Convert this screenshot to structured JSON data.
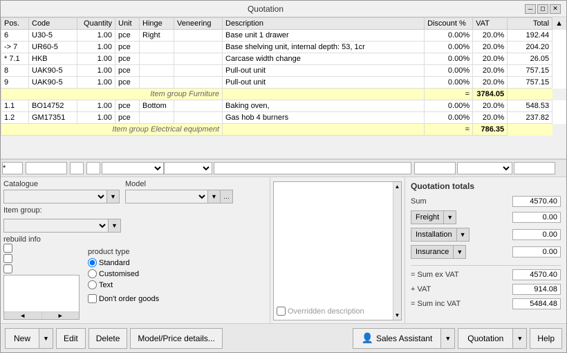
{
  "window": {
    "title": "Quotation"
  },
  "table": {
    "headers": [
      "Pos.",
      "Code",
      "Quantity",
      "Unit",
      "Hinge",
      "Veneering",
      "Description",
      "Discount %",
      "VAT",
      "Total"
    ],
    "rows": [
      {
        "pos": "6",
        "code": "U30-5",
        "qty": "1.00",
        "unit": "pce",
        "hinge": "Right",
        "veneer": "",
        "desc": "Base unit 1 drawer",
        "disc": "0.00%",
        "vat": "20.0%",
        "total": "192.44",
        "type": "normal"
      },
      {
        "pos": "-> 7",
        "code": "UR60-5",
        "qty": "1.00",
        "unit": "pce",
        "hinge": "",
        "veneer": "",
        "desc": "Base shelving unit, internal depth: 53, 1cr",
        "disc": "0.00%",
        "vat": "20.0%",
        "total": "204.20",
        "type": "normal"
      },
      {
        "pos": "* 7.1",
        "code": "HKB",
        "qty": "1.00",
        "unit": "pce",
        "hinge": "",
        "veneer": "",
        "desc": "Carcase width change",
        "disc": "0.00%",
        "vat": "20.0%",
        "total": "26.05",
        "type": "normal"
      },
      {
        "pos": "8",
        "code": "UAK90-5",
        "qty": "1.00",
        "unit": "pce",
        "hinge": "",
        "veneer": "",
        "desc": "Pull-out unit",
        "disc": "0.00%",
        "vat": "20.0%",
        "total": "757.15",
        "type": "normal"
      },
      {
        "pos": "9",
        "code": "UAK90-5",
        "qty": "1.00",
        "unit": "pce",
        "hinge": "",
        "veneer": "",
        "desc": "Pull-out unit",
        "disc": "0.00%",
        "vat": "20.0%",
        "total": "757.15",
        "type": "normal"
      },
      {
        "pos": "",
        "code": "",
        "qty": "",
        "unit": "",
        "hinge": "",
        "veneer": "Item group Furniture",
        "desc": "",
        "disc": "",
        "vat": "=",
        "total": "3784.05",
        "type": "group"
      },
      {
        "pos": "1.1",
        "code": "BO14752",
        "qty": "1.00",
        "unit": "pce",
        "hinge": "Bottom",
        "veneer": "",
        "desc": "Baking oven,",
        "disc": "0.00%",
        "vat": "20.0%",
        "total": "548.53",
        "type": "normal"
      },
      {
        "pos": "1.2",
        "code": "GM17351",
        "qty": "1.00",
        "unit": "pce",
        "hinge": "",
        "veneer": "",
        "desc": "Gas hob 4 burners",
        "disc": "0.00%",
        "vat": "20.0%",
        "total": "237.82",
        "type": "normal"
      },
      {
        "pos": "",
        "code": "",
        "qty": "",
        "unit": "",
        "hinge": "",
        "veneer": "Item group Electrical equipment",
        "desc": "",
        "disc": "",
        "vat": "=",
        "total": "786.35",
        "type": "group"
      }
    ]
  },
  "divider": {
    "placeholder1": "",
    "placeholder2": "...",
    "placeholder3": ""
  },
  "left_panel": {
    "catalogue_label": "Catalogue",
    "model_label": "Model",
    "item_group_label": "Item group:",
    "rebuild_label": "rebuild info",
    "product_type_label": "product type",
    "standard_label": "Standard",
    "customised_label": "Customised",
    "text_label": "Text",
    "dont_order_label": "Don't order goods"
  },
  "middle_panel": {
    "overridden_label": "Overridden description"
  },
  "right_panel": {
    "title": "Quotation totals",
    "sum_label": "Sum",
    "sum_value": "4570.40",
    "freight_label": "Freight",
    "freight_value": "0.00",
    "installation_label": "Installation",
    "installation_value": "0.00",
    "insurance_label": "Insurance",
    "insurance_value": "0.00",
    "sum_ex_vat_label": "= Sum ex VAT",
    "sum_ex_vat_value": "4570.40",
    "vat_label": "+ VAT",
    "vat_value": "914.08",
    "sum_inc_vat_label": "= Sum inc VAT",
    "sum_inc_vat_value": "5484.48"
  },
  "bottom_bar": {
    "new_label": "New",
    "edit_label": "Edit",
    "delete_label": "Delete",
    "model_price_label": "Model/Price details...",
    "sales_assistant_label": "Sales Assistant",
    "quotation_label": "Quotation",
    "help_label": "Help"
  }
}
